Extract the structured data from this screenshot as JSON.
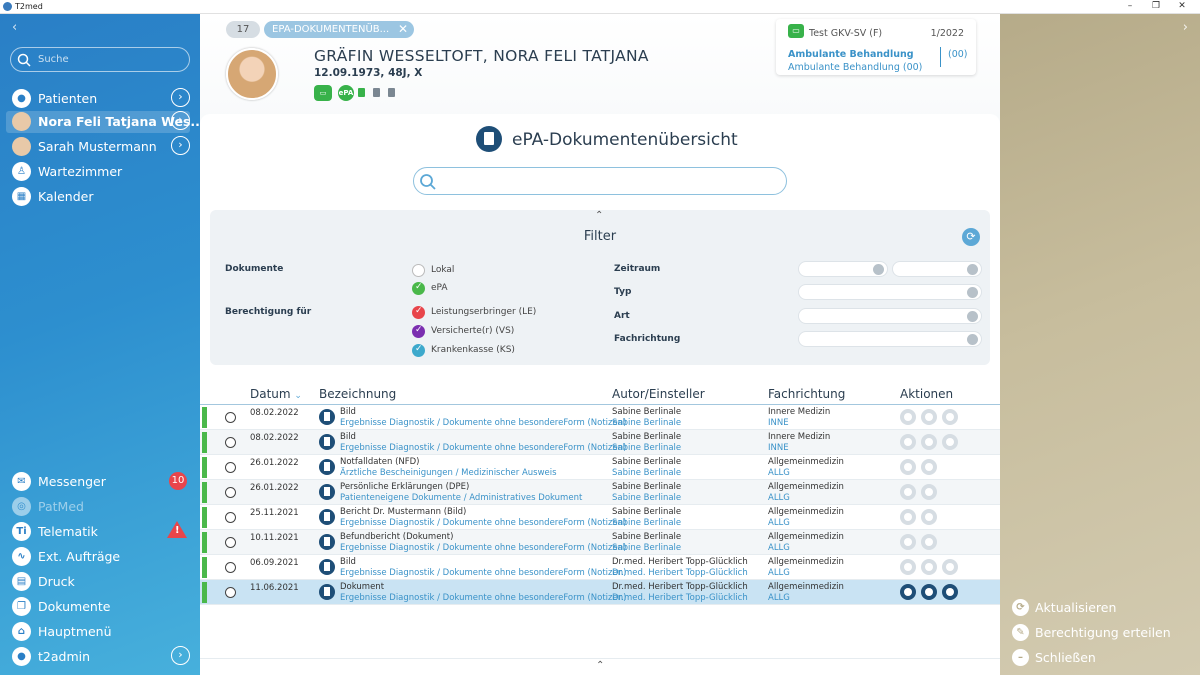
{
  "window": {
    "title": "T2med"
  },
  "sidebar": {
    "search_placeholder": "Suche",
    "items_top": [
      {
        "label": "Patienten",
        "icon": "person-icon"
      },
      {
        "label": "Nora Feli Tatjana Wes...",
        "icon": "avatar"
      },
      {
        "label": "Sarah Mustermann",
        "icon": "avatar"
      },
      {
        "label": "Wartezimmer",
        "icon": "chair-icon"
      },
      {
        "label": "Kalender",
        "icon": "calendar-icon"
      }
    ],
    "items_bottom": [
      {
        "label": "Messenger",
        "badge": "10"
      },
      {
        "label": "PatMed"
      },
      {
        "label": "Telematik",
        "icon_text": "Ti"
      },
      {
        "label": "Ext. Aufträge"
      },
      {
        "label": "Druck"
      },
      {
        "label": "Dokumente"
      },
      {
        "label": "Hauptmenü"
      },
      {
        "label": "t2admin"
      }
    ]
  },
  "header": {
    "tab_number": "17",
    "tab_label": "EPA-DOKUMENTENÜB...",
    "patient_name": "GRÄFIN WESSELTOFT,  NORA FELI TATJANA",
    "patient_info": "12.09.1973, 48J, X",
    "epa_label": "ePA",
    "insurance": {
      "name": "Test GKV-SV (F)",
      "quarter": "1/2022",
      "treatment_bold": "Ambulante Behandlung",
      "treatment": "Ambulante Behandlung (00)",
      "code": "(00)"
    }
  },
  "main": {
    "title": "ePA-Dokumentenübersicht",
    "filter": {
      "title": "Filter",
      "documents_label": "Dokumente",
      "documents_options": [
        "Lokal",
        "ePA"
      ],
      "permission_label": "Berechtigung für",
      "permission_options": [
        "Leistungserbringer (LE)",
        "Versicherte(r) (VS)",
        "Krankenkasse (KS)"
      ],
      "period_label": "Zeitraum",
      "type_label": "Typ",
      "kind_label": "Art",
      "specialty_label": "Fachrichtung"
    },
    "table": {
      "columns": [
        "Datum",
        "Bezeichnung",
        "Autor/Einsteller",
        "Fachrichtung",
        "Aktionen"
      ],
      "rows": [
        {
          "date": "08.02.2022",
          "title": "Bild",
          "sub": "Ergebnisse Diagnostik / Dokumente ohne besondereForm (Notizen)",
          "author": "Sabine Berlinale",
          "author2": "Sabine Berlinale",
          "spec": "Innere Medizin",
          "spec2": "INNE"
        },
        {
          "date": "08.02.2022",
          "title": "Bild",
          "sub": "Ergebnisse Diagnostik / Dokumente ohne besondereForm (Notizen)",
          "author": "Sabine Berlinale",
          "author2": "Sabine Berlinale",
          "spec": "Innere Medizin",
          "spec2": "INNE"
        },
        {
          "date": "26.01.2022",
          "title": "Notfalldaten (NFD)",
          "sub": "Ärztliche Bescheinigungen / Medizinischer Ausweis",
          "author": "Sabine Berlinale",
          "author2": "Sabine Berlinale",
          "spec": "Allgemeinmedizin",
          "spec2": "ALLG"
        },
        {
          "date": "26.01.2022",
          "title": "Persönliche Erklärungen (DPE)",
          "sub": "Patienteneigene Dokumente / Administratives Dokument",
          "author": "Sabine Berlinale",
          "author2": "Sabine Berlinale",
          "spec": "Allgemeinmedizin",
          "spec2": "ALLG"
        },
        {
          "date": "25.11.2021",
          "title": "Bericht Dr. Mustermann (Bild)",
          "sub": "Ergebnisse Diagnostik / Dokumente ohne besondereForm (Notizen)",
          "author": "Sabine Berlinale",
          "author2": "Sabine Berlinale",
          "spec": "Allgemeinmedizin",
          "spec2": "ALLG"
        },
        {
          "date": "10.11.2021",
          "title": "Befundbericht (Dokument)",
          "sub": "Ergebnisse Diagnostik / Dokumente ohne besondereForm (Notizen)",
          "author": "Sabine Berlinale",
          "author2": "Sabine Berlinale",
          "spec": "Allgemeinmedizin",
          "spec2": "ALLG"
        },
        {
          "date": "06.09.2021",
          "title": "Bild",
          "sub": "Ergebnisse Diagnostik / Dokumente ohne besondereForm (Notizen)",
          "author": "Dr.med. Heribert Topp-Glücklich",
          "author2": "Dr.med. Heribert Topp-Glücklich",
          "spec": "Allgemeinmedizin",
          "spec2": "ALLG"
        },
        {
          "date": "11.06.2021",
          "title": "Dokument",
          "sub": "Ergebnisse Diagnostik / Dokumente ohne besondereForm (Notizen)",
          "author": "Dr.med. Heribert Topp-Glücklich",
          "author2": "Dr.med. Heribert Topp-Glücklich",
          "spec": "Allgemeinmedizin",
          "spec2": "ALLG"
        }
      ]
    }
  },
  "right_panel": {
    "actions": [
      "Aktualisieren",
      "Berechtigung erteilen",
      "Schließen"
    ]
  },
  "colors": {
    "sidebar": "#2a7fc6",
    "accent": "#3a92c8",
    "success": "#4ab84a",
    "danger": "#e8454b"
  }
}
